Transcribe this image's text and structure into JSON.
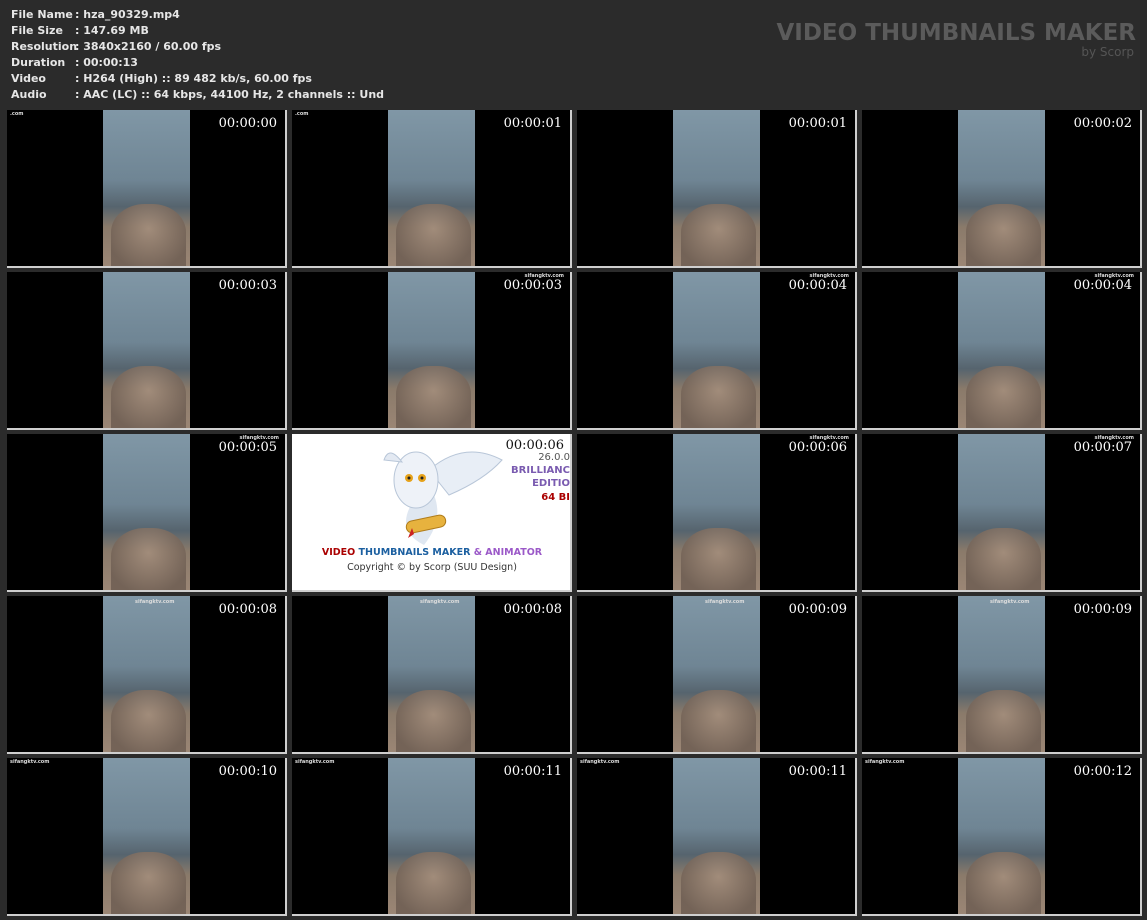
{
  "info": [
    {
      "label": "File Name",
      "value": "hza_90329.mp4"
    },
    {
      "label": "File Size",
      "value": "147.69 MB"
    },
    {
      "label": "Resolution",
      "value": "3840x2160 / 60.00 fps"
    },
    {
      "label": "Duration",
      "value": "00:00:13"
    },
    {
      "label": "Video",
      "value": "H264 (High) :: 89 482 kb/s, 60.00 fps"
    },
    {
      "label": "Audio",
      "value": "AAC (LC) :: 64 kbps, 44100 Hz, 2 channels :: Und"
    }
  ],
  "brand": {
    "title": "VIDEO THUMBNAILS MAKER",
    "subtitle": "by Scorp"
  },
  "splash": {
    "version": "26.0.0",
    "edition_1": "BRILLIANC",
    "edition_2": "EDITIO",
    "bits": "64 BI",
    "product_a": "VIDEO",
    "product_b": "THUMBNAILS MAKER",
    "product_c": "& ANIMATOR",
    "copyright": "Copyright © by Scorp (SUU Design)"
  },
  "thumbnails": [
    {
      "time": "00:00:00",
      "watermark": ".com",
      "watermark_pos": "top-left"
    },
    {
      "time": "00:00:01",
      "watermark": ".com",
      "watermark_pos": "top-left"
    },
    {
      "time": "00:00:01",
      "watermark": "",
      "watermark_pos": ""
    },
    {
      "time": "00:00:02",
      "watermark": "",
      "watermark_pos": ""
    },
    {
      "time": "00:00:03",
      "watermark": "",
      "watermark_pos": ""
    },
    {
      "time": "00:00:03",
      "watermark": "sifangktv.com",
      "watermark_pos": "top-right"
    },
    {
      "time": "00:00:04",
      "watermark": "sifangktv.com",
      "watermark_pos": "top-right"
    },
    {
      "time": "00:00:04",
      "watermark": "sifangktv.com",
      "watermark_pos": "top-right"
    },
    {
      "time": "00:00:05",
      "watermark": "sifangktv.com",
      "watermark_pos": "top-right"
    },
    {
      "time": "00:00:06",
      "splash": true
    },
    {
      "time": "00:00:06",
      "watermark": "sifangktv.com",
      "watermark_pos": "top-right"
    },
    {
      "time": "00:00:07",
      "watermark": "sifangktv.com",
      "watermark_pos": "top-right"
    },
    {
      "time": "00:00:08",
      "watermark": "sifangktv.com",
      "watermark_pos": "top-center"
    },
    {
      "time": "00:00:08",
      "watermark": "sifangktv.com",
      "watermark_pos": "top-center"
    },
    {
      "time": "00:00:09",
      "watermark": "sifangktv.com",
      "watermark_pos": "top-center"
    },
    {
      "time": "00:00:09",
      "watermark": "sifangktv.com",
      "watermark_pos": "top-center"
    },
    {
      "time": "00:00:10",
      "watermark": "sifangktv.com",
      "watermark_pos": "top-left"
    },
    {
      "time": "00:00:11",
      "watermark": "sifangktv.com",
      "watermark_pos": "top-left"
    },
    {
      "time": "00:00:11",
      "watermark": "sifangktv.com",
      "watermark_pos": "top-left"
    },
    {
      "time": "00:00:12",
      "watermark": "sifangktv.com",
      "watermark_pos": "top-left"
    }
  ]
}
